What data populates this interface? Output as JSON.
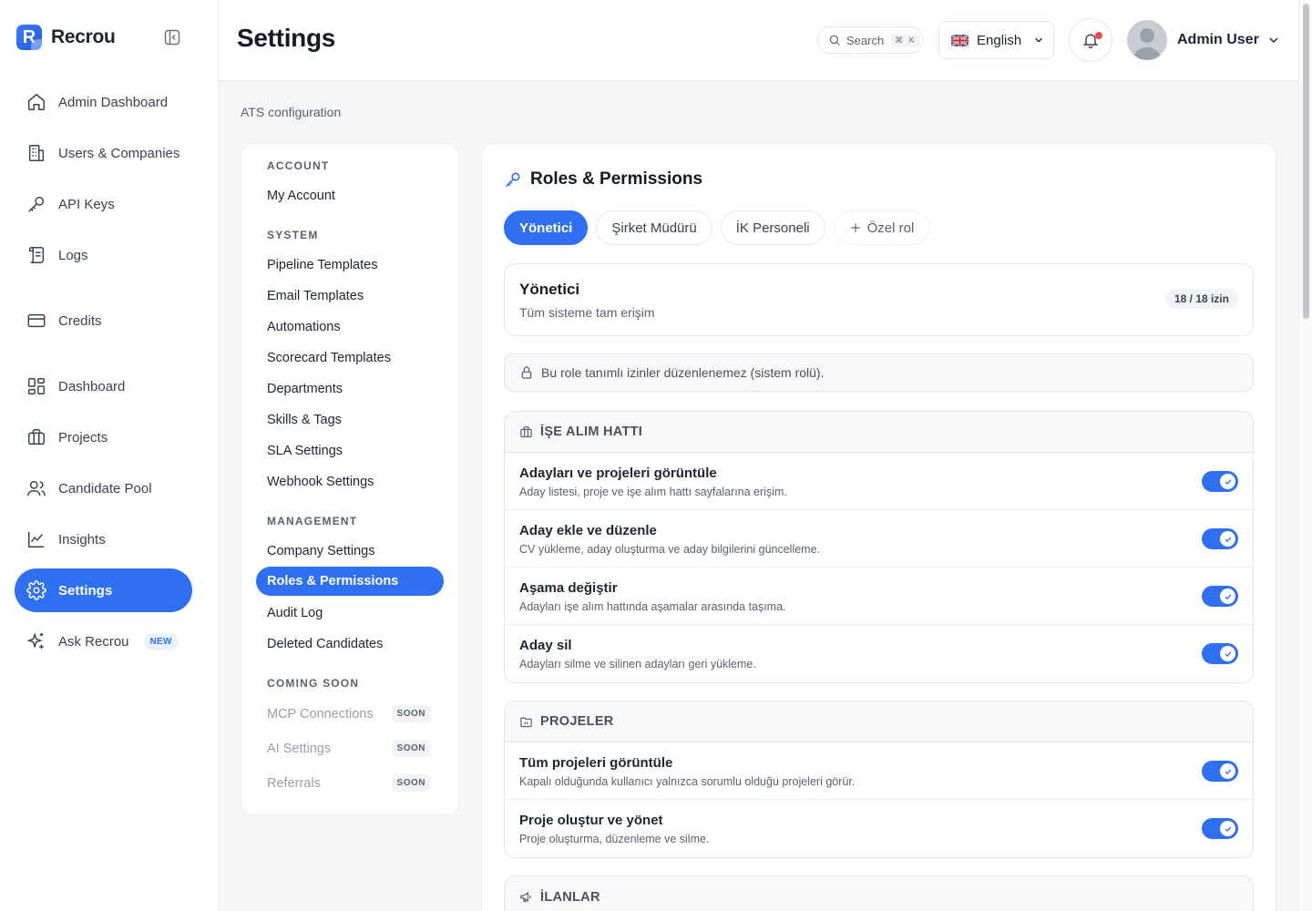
{
  "app": {
    "name": "Recrou"
  },
  "sidebar": {
    "items": [
      {
        "label": "Admin Dashboard",
        "icon": "home-icon"
      },
      {
        "label": "Users & Companies",
        "icon": "building-icon"
      },
      {
        "label": "API Keys",
        "icon": "key-icon"
      },
      {
        "label": "Logs",
        "icon": "scroll-icon"
      },
      {
        "label": "Credits",
        "icon": "credit-card-icon"
      },
      {
        "label": "Dashboard",
        "icon": "dashboard-icon"
      },
      {
        "label": "Projects",
        "icon": "briefcase-icon"
      },
      {
        "label": "Candidate Pool",
        "icon": "users-icon"
      },
      {
        "label": "Insights",
        "icon": "chart-icon"
      },
      {
        "label": "Settings",
        "icon": "gear-icon",
        "active": true
      },
      {
        "label": "Ask Recrou",
        "icon": "sparkles-icon",
        "badge": "NEW"
      }
    ]
  },
  "header": {
    "title": "Settings",
    "search": {
      "label": "Search",
      "shortcut": "⌘ K"
    },
    "language": "English",
    "user": "Admin User"
  },
  "breadcrumb": "ATS configuration",
  "settings_nav": {
    "sections": [
      {
        "heading": "ACCOUNT",
        "items": [
          "My Account"
        ]
      },
      {
        "heading": "SYSTEM",
        "items": [
          "Pipeline Templates",
          "Email Templates",
          "Automations",
          "Scorecard Templates",
          "Departments",
          "Skills & Tags",
          "SLA Settings",
          "Webhook Settings"
        ]
      },
      {
        "heading": "MANAGEMENT",
        "items": [
          "Company Settings",
          "Roles & Permissions",
          "Audit Log",
          "Deleted Candidates"
        ]
      },
      {
        "heading": "COMING SOON",
        "items": [
          "MCP Connections",
          "AI Settings",
          "Referrals"
        ],
        "badge": "SOON"
      }
    ],
    "active": "Roles & Permissions"
  },
  "panel": {
    "title": "Roles & Permissions",
    "tabs": [
      "Yönetici",
      "Şirket Müdürü",
      "İK Personeli",
      "Özel rol"
    ],
    "active_tab": "Yönetici",
    "role": {
      "name": "Yönetici",
      "description": "Tüm sisteme tam erişim",
      "count": "18 / 18 izin"
    },
    "notice": "Bu role tanımlı izinler düzenlenemez (sistem rolü).",
    "groups": [
      {
        "title": "İŞE ALIM HATTI",
        "icon": "briefcase-icon",
        "permissions": [
          {
            "title": "Adayları ve projeleri görüntüle",
            "desc": "Aday listesi, proje ve işe alım hattı sayfalarına erişim.",
            "enabled": true
          },
          {
            "title": "Aday ekle ve düzenle",
            "desc": "CV yükleme, aday oluşturma ve aday bilgilerini güncelleme.",
            "enabled": true
          },
          {
            "title": "Aşama değiştir",
            "desc": "Adayları işe alım hattında aşamalar arasında taşıma.",
            "enabled": true
          },
          {
            "title": "Aday sil",
            "desc": "Adayları silme ve silinen adayları geri yükleme.",
            "enabled": true
          }
        ]
      },
      {
        "title": "PROJELER",
        "icon": "folder-icon",
        "permissions": [
          {
            "title": "Tüm projeleri görüntüle",
            "desc": "Kapalı olduğunda kullanıcı yalnızca sorumlu olduğu projeleri görür.",
            "enabled": true
          },
          {
            "title": "Proje oluştur ve yönet",
            "desc": "Proje oluşturma, düzenleme ve silme.",
            "enabled": true
          }
        ]
      },
      {
        "title": "İLANLAR",
        "icon": "megaphone-icon",
        "permissions": []
      }
    ]
  },
  "colors": {
    "accent": "#2f6ff2",
    "notification_dot": "#f04a4a"
  }
}
